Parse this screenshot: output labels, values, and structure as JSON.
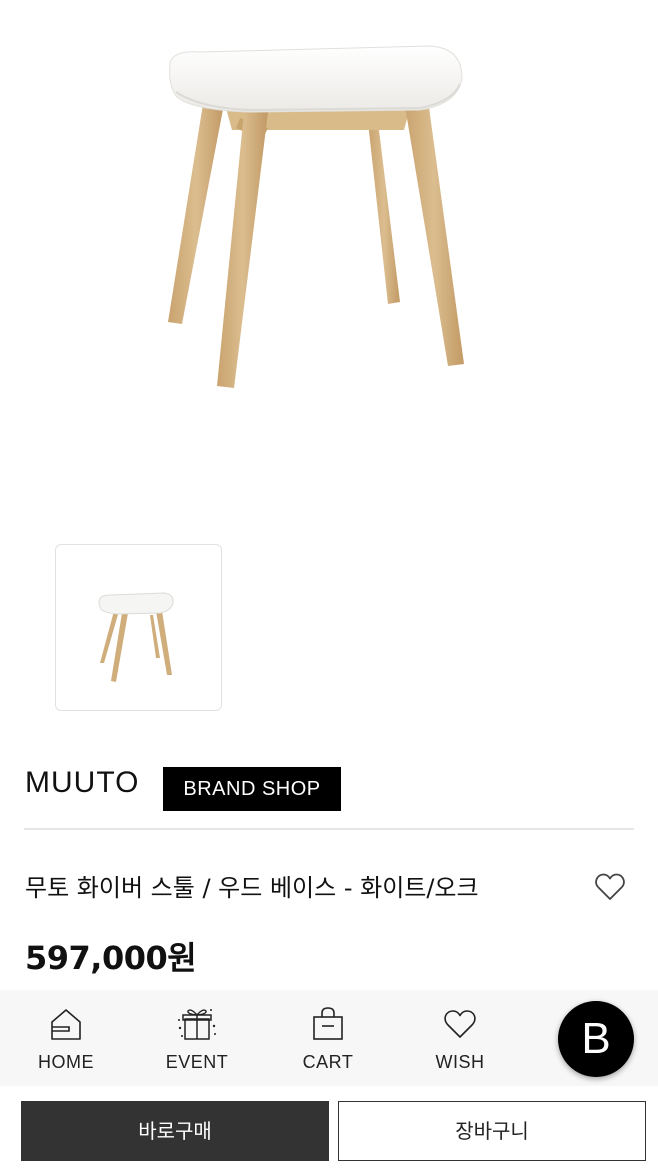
{
  "product": {
    "brand": "MUUTO",
    "brand_shop_label": "BRAND SHOP",
    "title": "무토 화이버 스툴 / 우드 베이스 - 화이트/오크",
    "price": "597,000원",
    "image_alt": "stool-product-image"
  },
  "nav": {
    "home": "HOME",
    "event": "EVENT",
    "cart": "CART",
    "wish": "WISH"
  },
  "fab": {
    "label": "B"
  },
  "actions": {
    "buy_now": "바로구매",
    "add_to_cart": "장바구니"
  },
  "colors": {
    "primary_button": "#333333",
    "brand_badge": "#000000",
    "seat": "#f4f4f2",
    "wood": "#d2b07e"
  }
}
